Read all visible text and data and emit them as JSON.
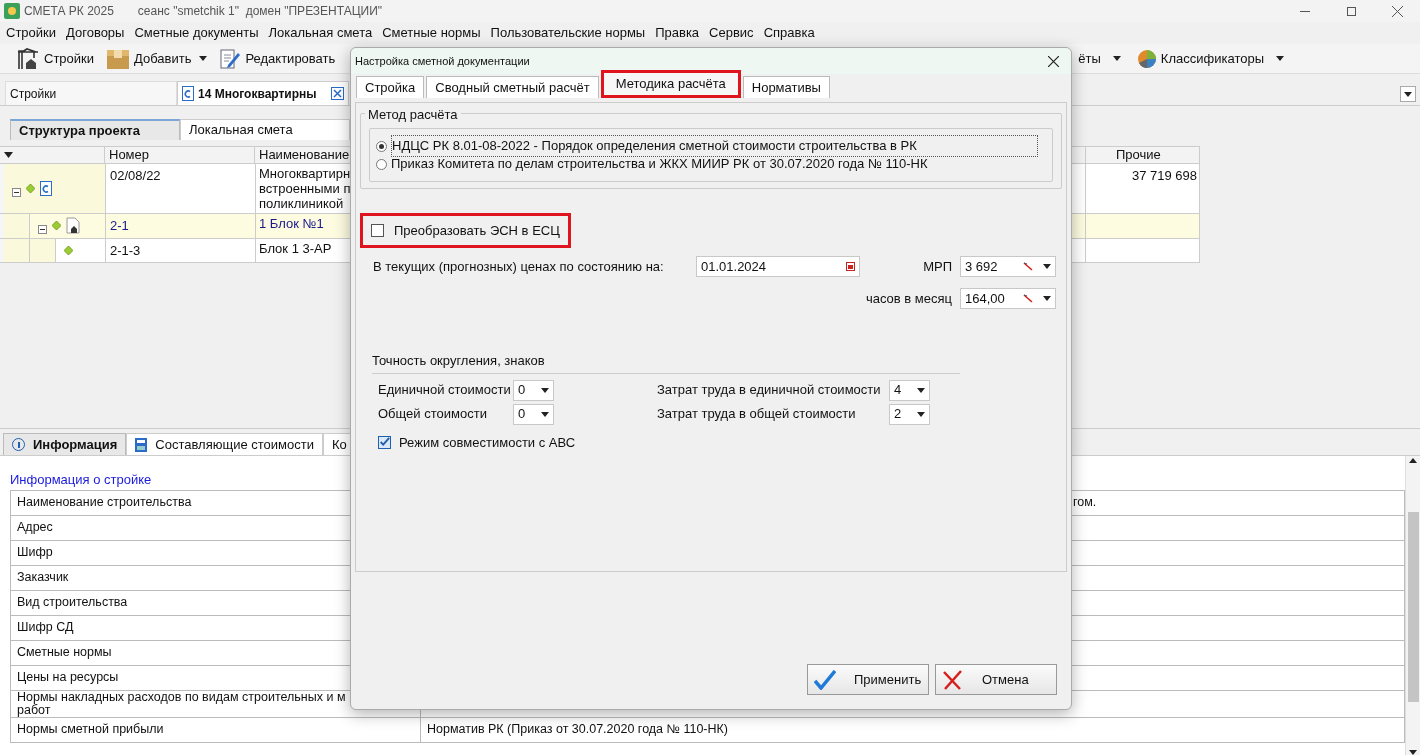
{
  "window": {
    "title": "СМЕТА РК 2025",
    "session": "сеанс \"smetchik 1\"  домен \"ПРЕЗЕНТАЦИИ\""
  },
  "menu": [
    "Стройки",
    "Договоры",
    "Сметные документы",
    "Локальная смета",
    "Сметные нормы",
    "Пользовательские нормы",
    "Правка",
    "Сервис",
    "Справка"
  ],
  "toolbar": [
    {
      "kind": "crane",
      "label": "Стройки",
      "dropdown": false
    },
    {
      "kind": "box",
      "label": "Добавить",
      "dropdown": true
    },
    {
      "kind": "pen",
      "label": "Редактировать",
      "dropdown": false
    }
  ],
  "toolbar_right": [
    {
      "kind": "none",
      "label": "ёты",
      "dropdown": true
    },
    {
      "kind": "pie",
      "label": "Классификаторы",
      "dropdown": true
    }
  ],
  "doc_tabs": [
    {
      "label": "Стройки",
      "selected": false,
      "closable": false
    },
    {
      "label": "14 Многоквартирны",
      "selected": true,
      "closable": true
    }
  ],
  "view_tabs": [
    {
      "label": "Структура проекта",
      "selected": true
    },
    {
      "label": "Локальная смета",
      "selected": false
    }
  ],
  "grid": {
    "columns": [
      "Номер",
      "Наименование",
      "Прочие"
    ],
    "rows": [
      {
        "kind": "project",
        "number": "02/08/22",
        "name": "Многоквартирн\nвстроенными п\nполиклиникой",
        "other": "37 719 698",
        "selected": false,
        "expanded": true,
        "children": [
          {
            "kind": "object",
            "number": "2-1",
            "name": "1 Блок №1",
            "selected": true,
            "expanded": true,
            "children": [
              {
                "number": "2-1-3",
                "name": "Блок 1 3-АР",
                "selected": false
              }
            ]
          }
        ]
      }
    ]
  },
  "bottom_tabs": [
    {
      "kind": "info",
      "label": "Информация",
      "selected": true
    },
    {
      "kind": "calc",
      "label": "Составляющие стоимости",
      "selected": false
    },
    {
      "kind": "none",
      "label": "Ко",
      "selected": false
    }
  ],
  "info": {
    "link": "Информация о стройке",
    "rows": [
      {
        "label": "Наименование строительства",
        "value": "гом.",
        "behind_dialog": true
      },
      {
        "label": "Адрес"
      },
      {
        "label": "Шифр"
      },
      {
        "label": "Заказчик"
      },
      {
        "label": "Вид строительства"
      },
      {
        "label": "Шифр СД"
      },
      {
        "label": "Сметные нормы"
      },
      {
        "label": "Цены на ресурсы"
      },
      {
        "label": "Нормы накладных расходов по видам строительных и м\nработ"
      },
      {
        "label": "Нормы сметной прибыли",
        "value": "Норматив РК (Приказ от 30.07.2020 года № 110-НК)",
        "behind_dialog": false
      }
    ]
  },
  "dialog": {
    "title": "Настройка сметной документации",
    "tabs": [
      {
        "label": "Стройка",
        "selected": false,
        "highlighted": false
      },
      {
        "label": "Сводный сметный расчёт",
        "selected": false,
        "highlighted": false
      },
      {
        "label": "Методика расчёта",
        "selected": true,
        "highlighted": true
      },
      {
        "label": "Нормативы",
        "selected": false,
        "highlighted": false
      }
    ],
    "method_group": "Метод расчёта",
    "methods": [
      {
        "label": "НДЦС РК 8.01-08-2022 - Порядок определения сметной стоимости строительства в РК",
        "selected": true
      },
      {
        "label": "Приказ Комитета по делам строительства и ЖКХ МИИР РК от 30.07.2020 года № 110-НК",
        "selected": false
      }
    ],
    "convert": {
      "label": "Преобразовать ЭСН в ЕСЦ",
      "checked": false,
      "highlighted": true
    },
    "date_label": "В текущих (прогнозных) ценах по состоянию на:",
    "date": "01.01.2024",
    "mrp_label": "МРП",
    "mrp": "3 692",
    "hours_label": "часов в месяц",
    "hours": "164,00",
    "rounding_group": "Точность округления, знаков",
    "rounding": [
      {
        "label": "Единичной стоимости",
        "value": "0"
      },
      {
        "label": "Затрат труда в единичной стоимости",
        "value": "4"
      },
      {
        "label": "Общей стоимости",
        "value": "0"
      },
      {
        "label": "Затрат труда в общей стоимости",
        "value": "2"
      }
    ],
    "compat": {
      "label": "Режим совместимости с АВС",
      "checked": true
    },
    "buttons": [
      {
        "kind": "ok",
        "label": "Применить"
      },
      {
        "kind": "cancel",
        "label": "Отмена"
      }
    ]
  }
}
